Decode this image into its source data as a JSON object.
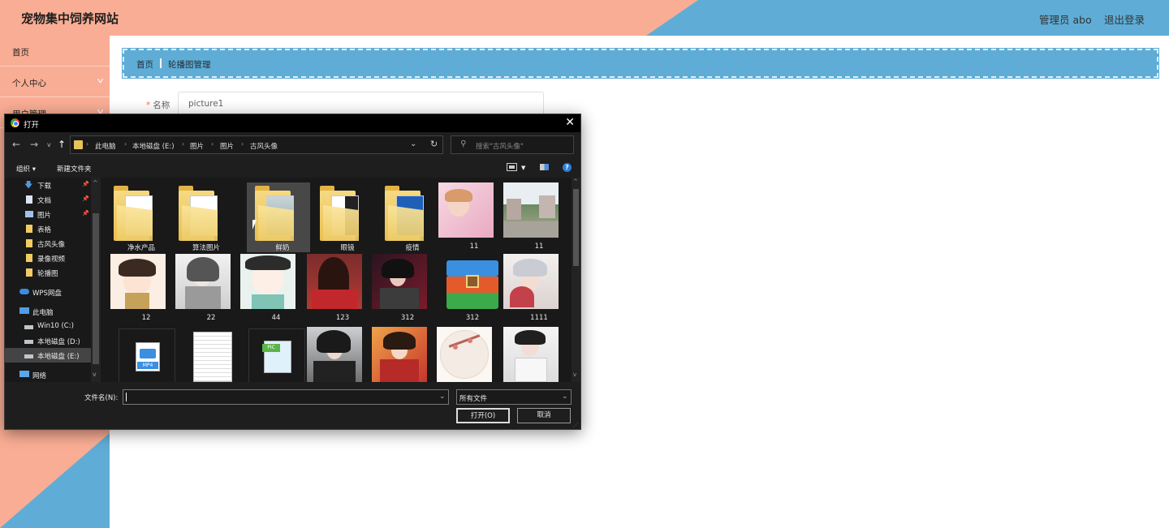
{
  "header": {
    "site_title": "宠物集中饲养网站",
    "admin_label": "管理员 abo",
    "logout": "退出登录"
  },
  "sidebar": {
    "items": [
      {
        "label": "首页",
        "has_chevron": false
      },
      {
        "label": "个人中心",
        "has_chevron": true
      },
      {
        "label": "用户管理",
        "has_chevron": true
      }
    ]
  },
  "breadcrumb": {
    "home": "首页",
    "current": "轮播图管理"
  },
  "form": {
    "name_label": "名称",
    "required_mark": "*",
    "name_value": "picture1"
  },
  "dialog": {
    "title": "打开",
    "close": "✕",
    "address": [
      "此电脑",
      "本地磁盘 (E:)",
      "图片",
      "图片",
      "古风头像"
    ],
    "search_placeholder": "搜索\"古风头像\"",
    "toolbar": {
      "organize": "组织 ▾",
      "new_folder": "新建文件夹",
      "help": "?"
    },
    "nav": [
      {
        "label": "下载",
        "pinned": true
      },
      {
        "label": "文档",
        "pinned": true
      },
      {
        "label": "图片",
        "pinned": true
      },
      {
        "label": "表格",
        "pinned": false
      },
      {
        "label": "古风头像",
        "pinned": false
      },
      {
        "label": "录像视频",
        "pinned": false
      },
      {
        "label": "轮播图",
        "pinned": false
      },
      {
        "label": "WPS网盘",
        "pinned": false
      },
      {
        "label": "此电脑",
        "pinned": false
      },
      {
        "label": "Win10 (C:)",
        "pinned": false
      },
      {
        "label": "本地磁盘 (D:)",
        "pinned": false
      },
      {
        "label": "本地磁盘 (E:)",
        "pinned": false,
        "selected": true
      },
      {
        "label": "网络",
        "pinned": false
      }
    ],
    "files": [
      {
        "name": "净水产品",
        "kind": "folder"
      },
      {
        "name": "算法图片",
        "kind": "folder"
      },
      {
        "name": "鲜奶",
        "kind": "folder",
        "selected": true
      },
      {
        "name": "眼镜",
        "kind": "folder"
      },
      {
        "name": "疫情",
        "kind": "folder"
      },
      {
        "name": "11",
        "kind": "photo"
      },
      {
        "name": "11",
        "kind": "photo"
      },
      {
        "name": "12",
        "kind": "photo"
      },
      {
        "name": "22",
        "kind": "photo"
      },
      {
        "name": "44",
        "kind": "photo"
      },
      {
        "name": "123",
        "kind": "photo"
      },
      {
        "name": "312",
        "kind": "photo"
      },
      {
        "name": "312",
        "kind": "archive"
      },
      {
        "name": "1111",
        "kind": "photo"
      },
      {
        "name": "",
        "kind": "video"
      },
      {
        "name": "",
        "kind": "document"
      },
      {
        "name": "",
        "kind": "image-file"
      },
      {
        "name": "",
        "kind": "photo"
      },
      {
        "name": "",
        "kind": "photo"
      },
      {
        "name": "",
        "kind": "photo"
      },
      {
        "name": "",
        "kind": "photo"
      }
    ],
    "filename_label": "文件名(N):",
    "filename_value": "",
    "filetype": "所有文件",
    "open_button": "打开(O)",
    "cancel_button": "取消",
    "video_badge": "MP4",
    "image_badge": "PIC"
  },
  "colors": {
    "salmon": "#f9ad94",
    "blue": "#5fadd6",
    "dialog_bg": "#191919"
  }
}
